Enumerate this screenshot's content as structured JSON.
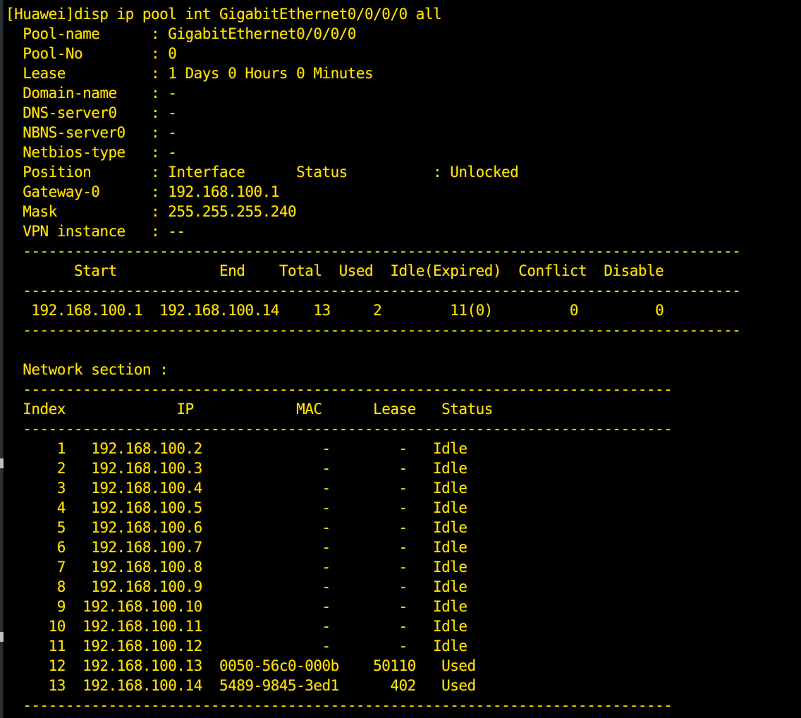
{
  "terminal": {
    "background_color": "#000000",
    "text_color": "#ffe400",
    "gutter_color": "#2b2f33",
    "columns": 93,
    "rows": 36
  },
  "prompt": {
    "hostname_bracket": "[Huawei]",
    "command": "disp ip pool int GigabitEthernet0/0/0/0 all",
    "full_line": "[Huawei]disp ip pool int GigabitEthernet0/0/0/0 all"
  },
  "pool_info": {
    "fields": [
      {
        "label": "Pool-name",
        "separator": ":",
        "value": "GigabitEthernet0/0/0/0"
      },
      {
        "label": "Pool-No",
        "separator": ":",
        "value": "0"
      },
      {
        "label": "Lease",
        "separator": ":",
        "value": "1 Days 0 Hours 0 Minutes"
      },
      {
        "label": "Domain-name",
        "separator": ":",
        "value": "-"
      },
      {
        "label": "DNS-server0",
        "separator": ":",
        "value": "-"
      },
      {
        "label": "NBNS-server0",
        "separator": ":",
        "value": "-"
      },
      {
        "label": "Netbios-type",
        "separator": ":",
        "value": "-"
      },
      {
        "label": "Position",
        "separator": ":",
        "value": "Interface"
      },
      {
        "label": "Gateway-0",
        "separator": ":",
        "value": "192.168.100.1"
      },
      {
        "label": "Mask",
        "separator": ":",
        "value": "255.255.255.240"
      },
      {
        "label": "VPN instance",
        "separator": ":",
        "value": "--"
      }
    ],
    "status_label": "Status",
    "status_separator": ":",
    "status_value": "Unlocked"
  },
  "summary_table": {
    "rule": "--------------------------------------------------------------------------------------",
    "headers": [
      "Start",
      "End",
      "Total",
      "Used",
      "Idle(Expired)",
      "Conflict",
      "Disable"
    ],
    "rows": [
      {
        "start": "192.168.100.1",
        "end": "192.168.100.14",
        "total": "13",
        "used": "2",
        "idle_expired": "11(0)",
        "conflict": "0",
        "disable": "0"
      }
    ],
    "header_line": "        Start            End    Total  Used  Idle(Expired)  Conflict  Disable",
    "row_lines": [
      "  192.168.100.1  192.168.100.14    13     2        11(0)         0         0"
    ]
  },
  "network_section": {
    "title": "Network section :",
    "rule": "------------------------------------------------------------------------------------",
    "headers": [
      "Index",
      "IP",
      "MAC",
      "Lease",
      "Status"
    ],
    "header_line": "  Index             IP            MAC      Lease   Status",
    "rows": [
      {
        "index": "1",
        "ip": "192.168.100.2",
        "mac": "-",
        "lease": "-",
        "status": "Idle"
      },
      {
        "index": "2",
        "ip": "192.168.100.3",
        "mac": "-",
        "lease": "-",
        "status": "Idle"
      },
      {
        "index": "3",
        "ip": "192.168.100.4",
        "mac": "-",
        "lease": "-",
        "status": "Idle"
      },
      {
        "index": "4",
        "ip": "192.168.100.5",
        "mac": "-",
        "lease": "-",
        "status": "Idle"
      },
      {
        "index": "5",
        "ip": "192.168.100.6",
        "mac": "-",
        "lease": "-",
        "status": "Idle"
      },
      {
        "index": "6",
        "ip": "192.168.100.7",
        "mac": "-",
        "lease": "-",
        "status": "Idle"
      },
      {
        "index": "7",
        "ip": "192.168.100.8",
        "mac": "-",
        "lease": "-",
        "status": "Idle"
      },
      {
        "index": "8",
        "ip": "192.168.100.9",
        "mac": "-",
        "lease": "-",
        "status": "Idle"
      },
      {
        "index": "9",
        "ip": "192.168.100.10",
        "mac": "-",
        "lease": "-",
        "status": "Idle"
      },
      {
        "index": "10",
        "ip": "192.168.100.11",
        "mac": "-",
        "lease": "-",
        "status": "Idle"
      },
      {
        "index": "11",
        "ip": "192.168.100.12",
        "mac": "-",
        "lease": "-",
        "status": "Idle"
      },
      {
        "index": "12",
        "ip": "192.168.100.13",
        "mac": "0050-56c0-000b",
        "lease": "50110",
        "status": "Used"
      },
      {
        "index": "13",
        "ip": "192.168.100.14",
        "mac": "5489-9845-3ed1",
        "lease": "402",
        "status": "Used"
      }
    ],
    "row_lines": [
      "      1   192.168.100.2              -        -   Idle",
      "      2   192.168.100.3              -        -   Idle",
      "      3   192.168.100.4              -        -   Idle",
      "      4   192.168.100.5              -        -   Idle",
      "      5   192.168.100.6              -        -   Idle",
      "      6   192.168.100.7              -        -   Idle",
      "      7   192.168.100.8              -        -   Idle",
      "      8   192.168.100.9              -        -   Idle",
      "      9  192.168.100.10              -        -   Idle",
      "     10  192.168.100.11              -        -   Idle",
      "     11  192.168.100.12              -        -   Idle",
      "     12  192.168.100.13  0050-56c0-000b    50110   Used",
      "     13  192.168.100.14  5489-9845-3ed1      402   Used"
    ]
  },
  "screen_lines": [
    {
      "id": "prompt",
      "text": "[Huawei]disp ip pool int GigabitEthernet0/0/0/0 all"
    },
    {
      "id": "field-pool-name",
      "text": "  Pool-name      : GigabitEthernet0/0/0/0"
    },
    {
      "id": "field-pool-no",
      "text": "  Pool-No        : 0"
    },
    {
      "id": "field-lease",
      "text": "  Lease          : 1 Days 0 Hours 0 Minutes"
    },
    {
      "id": "field-domain-name",
      "text": "  Domain-name    : -"
    },
    {
      "id": "field-dns-server0",
      "text": "  DNS-server0    : -"
    },
    {
      "id": "field-nbns-server0",
      "text": "  NBNS-server0   : -"
    },
    {
      "id": "field-netbios-type",
      "text": "  Netbios-type   : -"
    },
    {
      "id": "field-position",
      "text": "  Position       : Interface      Status          : Unlocked"
    },
    {
      "id": "field-gateway-0",
      "text": "  Gateway-0      : 192.168.100.1"
    },
    {
      "id": "field-mask",
      "text": "  Mask           : 255.255.255.240"
    },
    {
      "id": "field-vpn-instance",
      "text": "  VPN instance   : --"
    },
    {
      "id": "rule-summary-top",
      "text": "  ------------------------------------------------------------------------------------",
      "rule": true
    },
    {
      "id": "summary-header",
      "text": "        Start            End    Total  Used  Idle(Expired)  Conflict  Disable"
    },
    {
      "id": "rule-summary-mid",
      "text": "  ------------------------------------------------------------------------------------",
      "rule": true
    },
    {
      "id": "summary-row-1",
      "text": "   192.168.100.1  192.168.100.14    13     2        11(0)         0         0"
    },
    {
      "id": "rule-summary-bot",
      "text": "  ------------------------------------------------------------------------------------",
      "rule": true
    },
    {
      "id": "blank-1",
      "text": ""
    },
    {
      "id": "network-title",
      "text": "  Network section :"
    },
    {
      "id": "rule-network-top",
      "text": "  ----------------------------------------------------------------------------",
      "rule": true
    },
    {
      "id": "network-header",
      "text": "  Index             IP            MAC      Lease   Status"
    },
    {
      "id": "rule-network-mid",
      "text": "  ----------------------------------------------------------------------------",
      "rule": true
    },
    {
      "id": "network-row-1",
      "text": "      1   192.168.100.2              -        -   Idle"
    },
    {
      "id": "network-row-2",
      "text": "      2   192.168.100.3              -        -   Idle"
    },
    {
      "id": "network-row-3",
      "text": "      3   192.168.100.4              -        -   Idle"
    },
    {
      "id": "network-row-4",
      "text": "      4   192.168.100.5              -        -   Idle"
    },
    {
      "id": "network-row-5",
      "text": "      5   192.168.100.6              -        -   Idle"
    },
    {
      "id": "network-row-6",
      "text": "      6   192.168.100.7              -        -   Idle"
    },
    {
      "id": "network-row-7",
      "text": "      7   192.168.100.8              -        -   Idle"
    },
    {
      "id": "network-row-8",
      "text": "      8   192.168.100.9              -        -   Idle"
    },
    {
      "id": "network-row-9",
      "text": "      9  192.168.100.10              -        -   Idle"
    },
    {
      "id": "network-row-10",
      "text": "     10  192.168.100.11              -        -   Idle"
    },
    {
      "id": "network-row-11",
      "text": "     11  192.168.100.12              -        -   Idle"
    },
    {
      "id": "network-row-12",
      "text": "     12  192.168.100.13  0050-56c0-000b    50110   Used"
    },
    {
      "id": "network-row-13",
      "text": "     13  192.168.100.14  5489-9845-3ed1      402   Used"
    },
    {
      "id": "rule-network-bot",
      "text": "  ----------------------------------------------------------------------------",
      "rule": true
    }
  ]
}
